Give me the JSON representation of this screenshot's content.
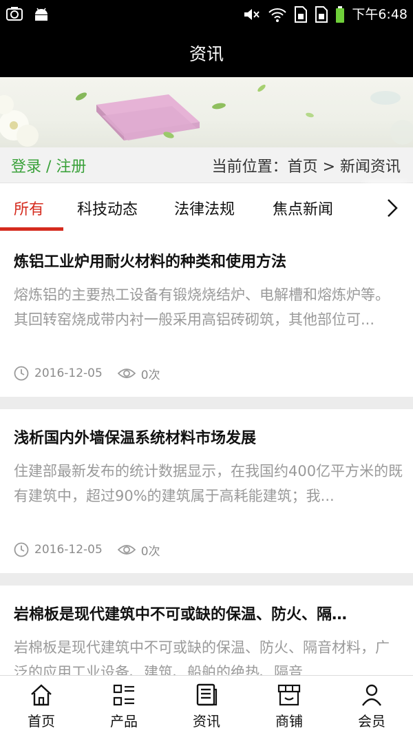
{
  "status_bar": {
    "time": "下午6:48",
    "icons": [
      "camera-icon",
      "android-icon",
      "mute-icon",
      "wifi-icon",
      "sim1-icon",
      "sim2-icon",
      "battery-icon"
    ]
  },
  "header": {
    "title": "资讯"
  },
  "subheader": {
    "auth_link": "登录 / 注册",
    "breadcrumb": "当前位置：首页 > 新闻资讯"
  },
  "tabs": [
    {
      "label": "所有",
      "active": true
    },
    {
      "label": "科技动态",
      "active": false
    },
    {
      "label": "法律法规",
      "active": false
    },
    {
      "label": "焦点新闻",
      "active": false
    }
  ],
  "articles": [
    {
      "title": "炼铝工业炉用耐火材料的种类和使用方法",
      "summary": "熔炼铝的主要热工设备有锻烧烧结炉、电解槽和熔炼炉等。其回转窑烧成带内衬一般采用高铝砖砌筑，其他部位可...",
      "date": "2016-12-05",
      "views": "0次"
    },
    {
      "title": "浅析国内外墙保温系统材料市场发展",
      "summary": "住建部最新发布的统计数据显示，在我国约400亿平方米的既有建筑中，超过90%的建筑属于高耗能建筑；我...",
      "date": "2016-12-05",
      "views": "0次"
    },
    {
      "title": "岩棉板是现代建筑中不可或缺的保温、防火、隔…",
      "summary": "岩棉板是现代建筑中不可或缺的保温、防火、隔音材料，广泛的应用工业设备、建筑、船舶的绝热、隔音",
      "date": "",
      "views": ""
    }
  ],
  "bottom_nav": [
    {
      "label": "首页",
      "icon": "home-icon"
    },
    {
      "label": "产品",
      "icon": "grid-list-icon"
    },
    {
      "label": "资讯",
      "icon": "news-icon"
    },
    {
      "label": "商铺",
      "icon": "shop-icon"
    },
    {
      "label": "会员",
      "icon": "user-icon"
    }
  ],
  "colors": {
    "accent": "#d52b1e",
    "auth_green": "#3aa13a",
    "header_bg": "#000000"
  }
}
